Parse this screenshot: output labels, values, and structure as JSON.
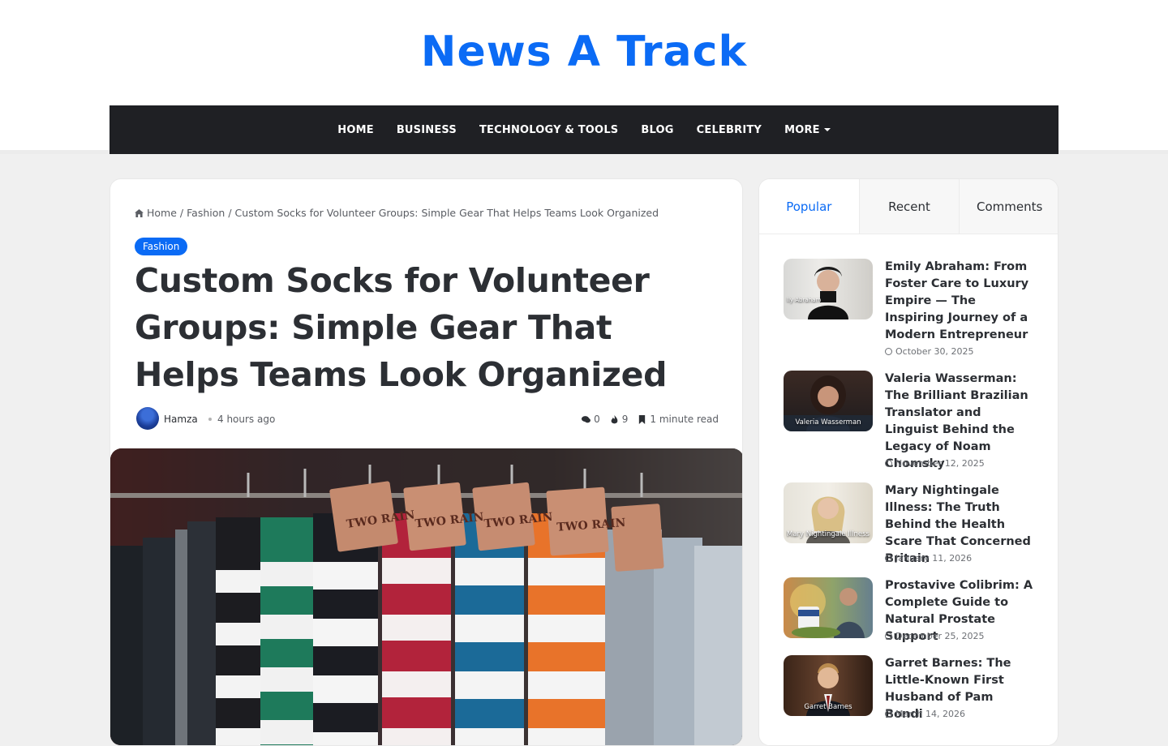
{
  "site": {
    "logo": "News A Track"
  },
  "nav": {
    "items": [
      "HOME",
      "BUSINESS",
      "TECHNOLOGY & TOOLS",
      "BLOG",
      "CELEBRITY",
      "MORE"
    ]
  },
  "breadcrumb": {
    "home": "Home",
    "category": "Fashion",
    "current": "Custom Socks for Volunteer Groups: Simple Gear That Helps Teams Look Organized",
    "separator": "/"
  },
  "article": {
    "category_badge": "Fashion",
    "title": "Custom Socks for Volunteer Groups: Simple Gear That Helps Teams Look Organized",
    "author": "Hamza",
    "time": "4 hours ago",
    "comments": "0",
    "views": "9",
    "read_time": "1 minute read",
    "hero_tag_text": "TWO RAIN"
  },
  "sidebar": {
    "tabs": [
      "Popular",
      "Recent",
      "Comments"
    ],
    "posts": [
      {
        "title": "Emily Abraham: From Foster Care to Luxury Empire — The Inspiring Journey of a Modern Entrepreneur",
        "date": "October 30, 2025",
        "thumb_caption": "lly Abraham"
      },
      {
        "title": "Valeria Wasserman: The Brilliant Brazilian Translator and Linguist Behind the Legacy of Noam Chomsky",
        "date": "November 12, 2025",
        "thumb_caption": "Valeria Wasserman"
      },
      {
        "title": "Mary Nightingale Illness: The Truth Behind the Health Scare That Concerned Britain",
        "date": "January 11, 2026",
        "thumb_caption": "Mary Nightingale Illness"
      },
      {
        "title": "Prostavive Colibrim: A Complete Guide to Natural Prostate Support",
        "date": "December 25, 2025",
        "thumb_caption": ""
      },
      {
        "title": "Garret Barnes: The Little-Known First Husband of Pam Bondi",
        "date": "March 14, 2026",
        "thumb_caption": "Garret Barnes"
      }
    ]
  },
  "colors": {
    "accent": "#0b6bf5",
    "nav_bg": "#1f2024",
    "text": "#2c2f34"
  }
}
